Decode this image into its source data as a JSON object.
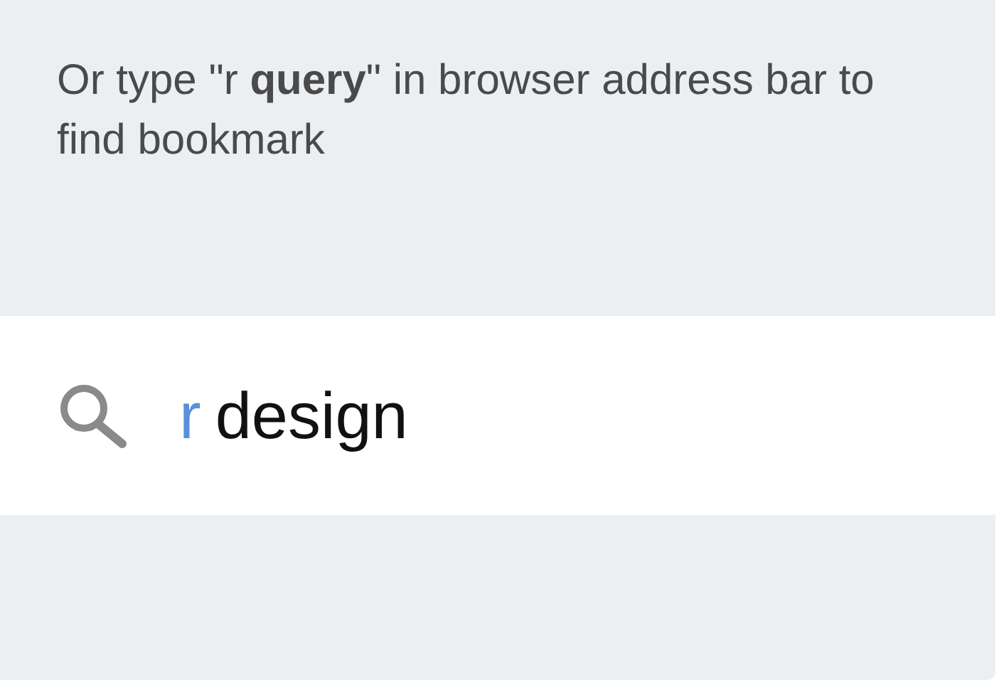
{
  "hint": "Or type \"r **query**\" in browser address bar to find bookmark",
  "omnibox": {
    "keyword": "r",
    "value": "design"
  }
}
